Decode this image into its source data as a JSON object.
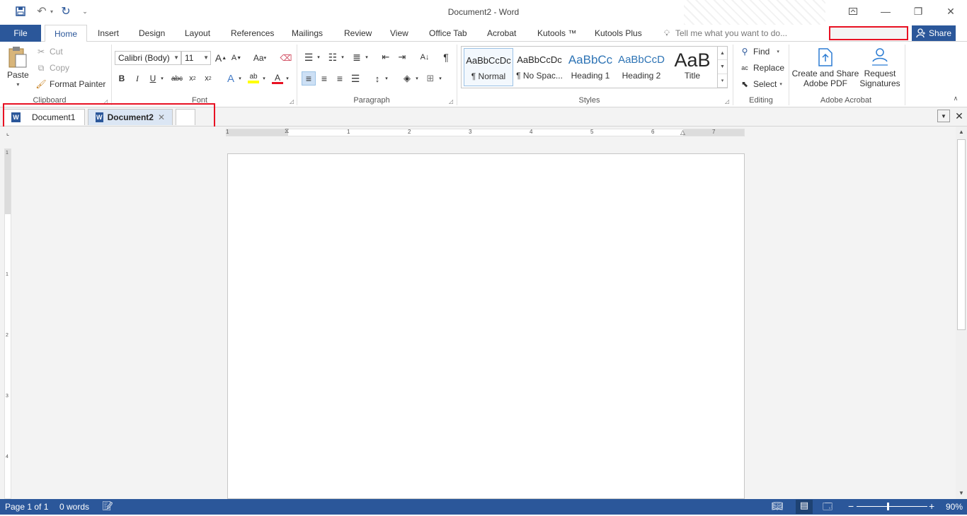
{
  "app": {
    "title": "Document2 - Word"
  },
  "qat": {
    "save_icon": "save-icon",
    "undo_icon": "undo-icon",
    "redo_icon": "redo-icon",
    "customize_icon": "customize-qat-icon"
  },
  "window": {
    "ribbon_display_icon": "ribbon-display-options-icon",
    "minimize": "—",
    "restore": "❐",
    "close": "✕"
  },
  "ribbon_tabs": [
    "File",
    "Home",
    "Insert",
    "Design",
    "Layout",
    "References",
    "Mailings",
    "Review",
    "View",
    "Office Tab",
    "Acrobat",
    "Kutools ™",
    "Kutools Plus"
  ],
  "tell_me": "Tell me what you want to do...",
  "share_label": "Share",
  "clipboard": {
    "paste": "Paste",
    "cut": "Cut",
    "copy": "Copy",
    "format_painter": "Format Painter",
    "label": "Clipboard"
  },
  "font": {
    "name": "Calibri (Body)",
    "size": "11",
    "label": "Font",
    "grow": "A",
    "shrink": "A",
    "case": "Aa"
  },
  "paragraph": {
    "label": "Paragraph",
    "pilcrow": "¶"
  },
  "styles": {
    "label": "Styles",
    "items": [
      {
        "preview": "AaBbCcDc",
        "name": "¶ Normal"
      },
      {
        "preview": "AaBbCcDc",
        "name": "¶ No Spac..."
      },
      {
        "preview": "AaBbCc",
        "name": "Heading 1"
      },
      {
        "preview": "AaBbCcD",
        "name": "Heading 2"
      },
      {
        "preview": "AaB",
        "name": "Title"
      }
    ]
  },
  "editing": {
    "find": "Find",
    "replace": "Replace",
    "select": "Select",
    "label": "Editing"
  },
  "acrobat": {
    "create_line1": "Create and Share",
    "create_line2": "Adobe PDF",
    "request_line1": "Request",
    "request_line2": "Signatures",
    "label": "Adobe Acrobat"
  },
  "doc_tabs": [
    {
      "label": "Document1",
      "active": false
    },
    {
      "label": "Document2",
      "active": true
    }
  ],
  "doc_tab_close": "✕",
  "ruler": {
    "h_numbers": [
      "1",
      "1",
      "2",
      "3",
      "4",
      "5",
      "6",
      "7"
    ],
    "v_numbers": [
      "1",
      "1",
      "2",
      "3",
      "4"
    ]
  },
  "status": {
    "page": "Page 1 of 1",
    "words": "0 words",
    "zoom": "90%",
    "zoom_level": 0.9
  },
  "colors": {
    "accent": "#2b579a",
    "highlight": "#e81123",
    "text_highlight": "#ffff00",
    "font_color": "#e81123"
  }
}
